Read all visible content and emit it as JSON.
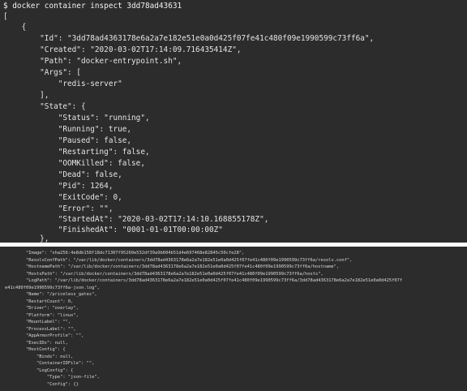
{
  "terminal_top": {
    "command": "$ docker container inspect 3dd78ad43631",
    "lines": [
      "[",
      "    {",
      "        \"Id\": \"3dd78ad4363178e6a2a7e182e51e0a0d425f07fe41c480f09e1990599c73ff6a\",",
      "        \"Created\": \"2020-03-02T17:14:09.716435414Z\",",
      "        \"Path\": \"docker-entrypoint.sh\",",
      "        \"Args\": [",
      "            \"redis-server\"",
      "        ],",
      "        \"State\": {",
      "            \"Status\": \"running\",",
      "            \"Running\": true,",
      "            \"Paused\": false,",
      "            \"Restarting\": false,",
      "            \"OOMKilled\": false,",
      "            \"Dead\": false,",
      "            \"Pid\": 1264,",
      "            \"ExitCode\": 0,",
      "            \"Error\": \"\",",
      "            \"StartedAt\": \"2020-03-02T17:14:10.168855178Z\",",
      "            \"FinishedAt\": \"0001-01-01T00:00:00Z\"",
      "        },"
    ]
  },
  "terminal_bottom": {
    "lines": [
      "        \"Image\": \"sha256:4e8db158f18dc71307f95260e532df39a9b604b51d4e697468e82845c50cfe28\",",
      "        \"ResolvConfPath\": \"/var/lib/docker/containers/3dd78ad4363178e6a2a7e182e51e0a0d425f07fe41c480f09e1990599c73ff6a/resolv.conf\",",
      "        \"HostnamePath\": \"/var/lib/docker/containers/3dd78ad4363178e6a2a7e182e51e0a0d425f07fe41c480f09e1990599c73ff6a/hostname\",",
      "        \"HostsPath\": \"/var/lib/docker/containers/3dd78ad4363178e6a2a7e182e51e0a0d425f07fe41c480f09e1990599c73ff6a/hosts\",",
      "        \"LogPath\": \"/var/lib/docker/containers/3dd78ad4363178e6a2a7e182e51e0a0d425f07fe41c480f09e1990599c73ff6a/3dd78ad4363178e6a2a7e182e51e0a0d425f07f",
      "e41c480f09e1990599c73ff6a-json.log\",",
      "        \"Name\": \"/priceless_gates\",",
      "        \"RestartCount\": 0,",
      "        \"Driver\": \"overlay\",",
      "        \"Platform\": \"linux\",",
      "        \"MountLabel\": \"\",",
      "        \"ProcessLabel\": \"\",",
      "        \"AppArmorProfile\": \"\",",
      "        \"ExecIDs\": null,",
      "        \"HostConfig\": {",
      "            \"Binds\": null,",
      "            \"ContainerIDFile\": \"\",",
      "            \"LogConfig\": {",
      "                \"Type\": \"json-file\",",
      "                \"Config\": {}"
    ]
  }
}
